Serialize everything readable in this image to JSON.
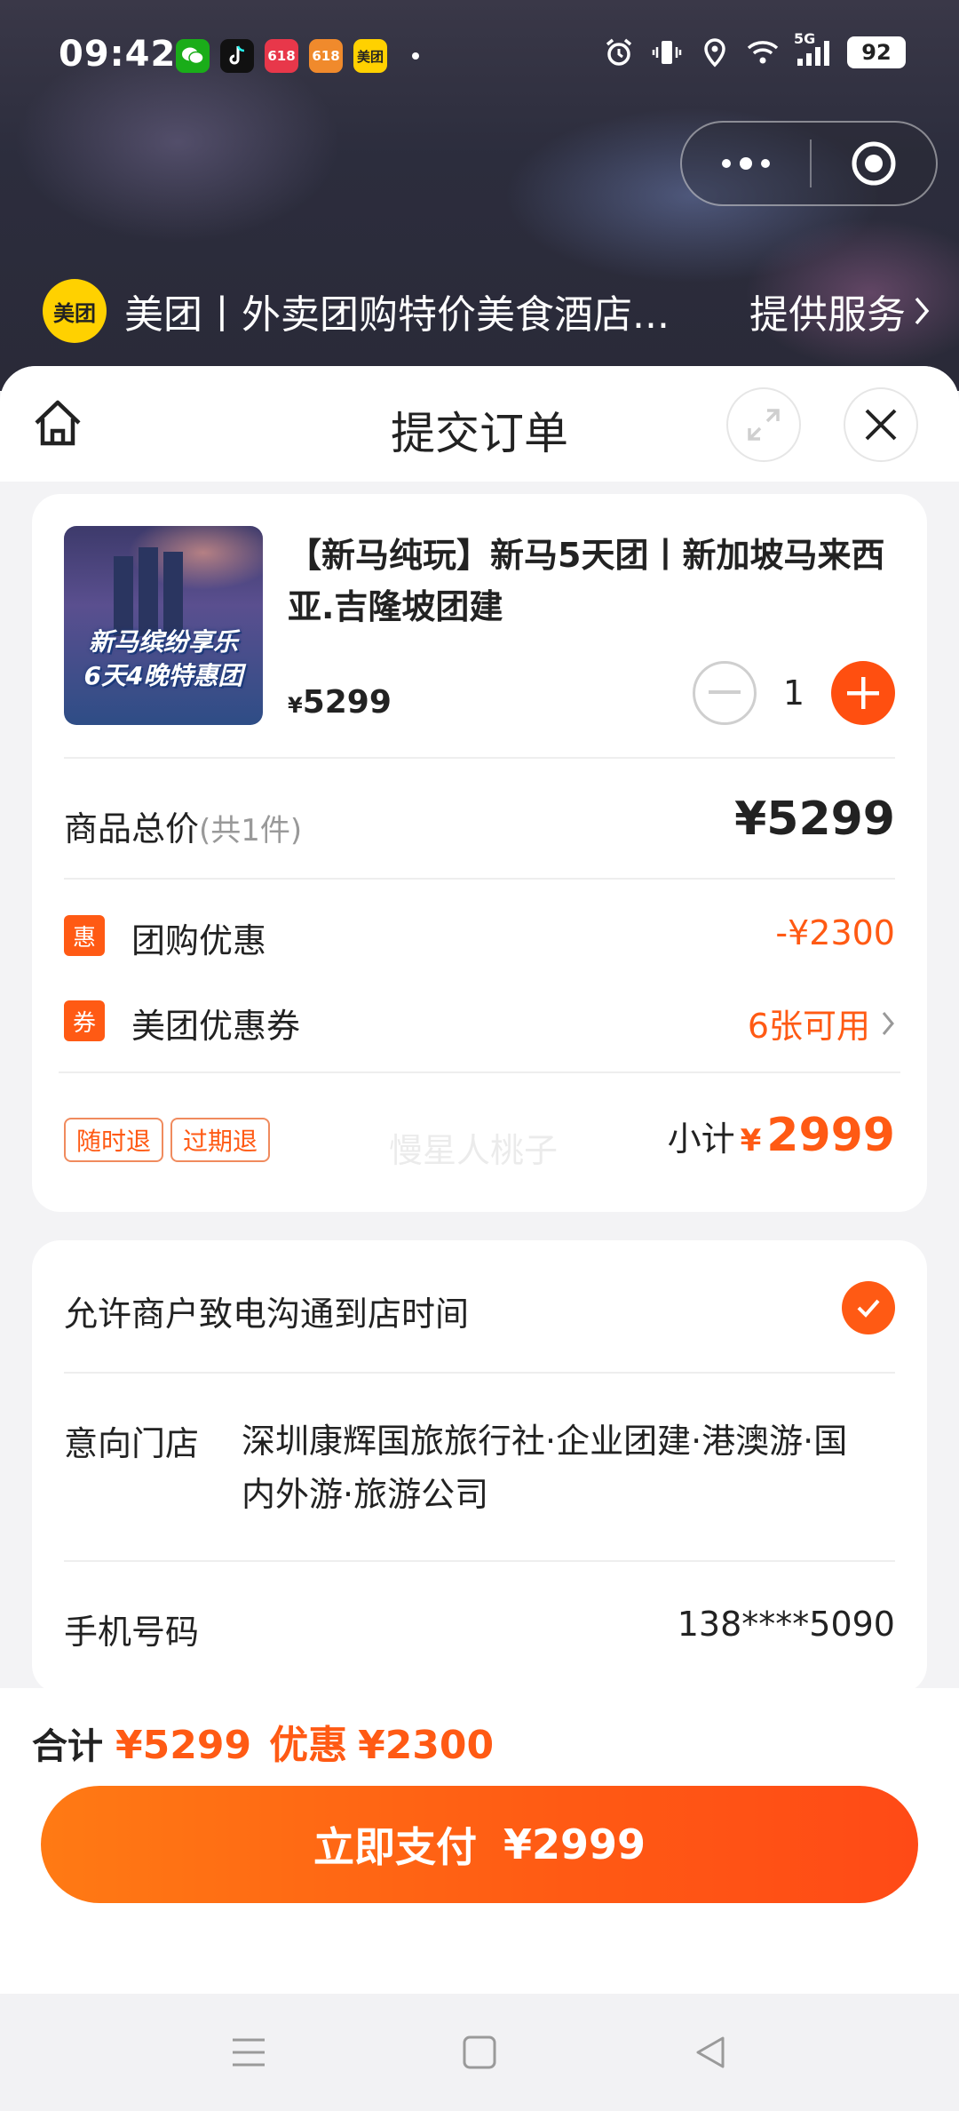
{
  "status_bar": {
    "time": "09:42",
    "battery": "92",
    "network": "5G",
    "app_icons": [
      {
        "name": "wechat-icon",
        "color": "#1aad19",
        "label": ""
      },
      {
        "name": "tiktok-icon",
        "color": "#111111",
        "label": ""
      },
      {
        "name": "app-618-icon",
        "color": "#e8374a",
        "label": "618"
      },
      {
        "name": "app-618b-icon",
        "color": "#f08a2c",
        "label": "618"
      },
      {
        "name": "meituan-mini-icon",
        "color": "#ffd100",
        "label": "美团"
      }
    ]
  },
  "mini_program": {
    "logo_text": "美团",
    "title": "美团丨外卖团购特价美食酒店...",
    "service_label": "提供服务"
  },
  "sheet": {
    "title": "提交订单"
  },
  "product": {
    "thumb_text_line1": "新马缤纷享乐",
    "thumb_text_line2": "6天4晚特惠团",
    "name": "【新马纯玩】新马5天团丨新加坡马来西亚.吉隆坡团建",
    "price_symbol": "¥",
    "price": "5299",
    "quantity": "1"
  },
  "summary": {
    "total_label": "商品总价",
    "total_count": "(共1件)",
    "total_value": "¥5299",
    "group_discount_icon": "惠",
    "group_discount_label": "团购优惠",
    "group_discount_value": "-¥2300",
    "coupon_icon": "券",
    "coupon_label": "美团优惠券",
    "coupon_value": "6张可用",
    "watermark": "慢星人桃子",
    "tags": [
      "随时退",
      "过期退"
    ],
    "subtotal_label": "小计",
    "subtotal_symbol": "¥",
    "subtotal_value": "2999"
  },
  "contact": {
    "allow_call_label": "允许商户致电沟通到店时间",
    "allow_call_checked": true,
    "store_label": "意向门店",
    "store_value": "深圳康辉国旅旅行社·企业团建·港澳游·国内外游·旅游公司",
    "phone_label": "手机号码",
    "phone_value": "138****5090"
  },
  "footer": {
    "sum_label": "合计",
    "sum_value": "¥5299",
    "discount_label": "优惠",
    "discount_value": "¥2300",
    "pay_label": "立即支付",
    "pay_amount": "¥2999"
  },
  "colors": {
    "accent": "#ff5a14",
    "meituan_yellow": "#ffd100"
  }
}
